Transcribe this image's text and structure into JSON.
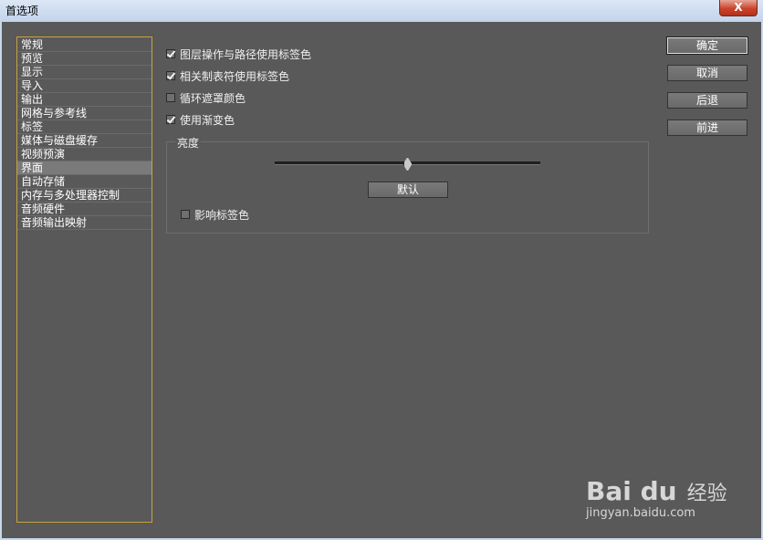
{
  "window": {
    "title": "首选项",
    "close_label": "X"
  },
  "sidebar": {
    "items": [
      {
        "label": "常规"
      },
      {
        "label": "预览"
      },
      {
        "label": "显示"
      },
      {
        "label": "导入"
      },
      {
        "label": "输出"
      },
      {
        "label": "网格与参考线"
      },
      {
        "label": "标签"
      },
      {
        "label": "媒体与磁盘缓存"
      },
      {
        "label": "视频预演"
      },
      {
        "label": "界面",
        "selected": true
      },
      {
        "label": "自动存储"
      },
      {
        "label": "内存与多处理器控制"
      },
      {
        "label": "音频硬件"
      },
      {
        "label": "音频输出映射"
      }
    ]
  },
  "options": [
    {
      "label": "图层操作与路径使用标签色",
      "checked": true
    },
    {
      "label": "相关制表符使用标签色",
      "checked": true
    },
    {
      "label": "循环遮罩颜色",
      "checked": false
    },
    {
      "label": "使用渐变色",
      "checked": true
    }
  ],
  "brightness": {
    "group_label": "亮度",
    "slider_value": 0.5,
    "default_button": "默认",
    "affect_label": "影响标签色",
    "affect_checked": false
  },
  "actions": {
    "ok": "确定",
    "cancel": "取消",
    "back": "后退",
    "forward": "前进"
  },
  "watermark": {
    "logo": "Bai du",
    "cn": "经验",
    "url": "jingyan.baidu.com"
  },
  "colors": {
    "panel_bg": "#595959",
    "sidebar_border": "#c8a23a",
    "selected_bg": "#7a7a7a"
  }
}
